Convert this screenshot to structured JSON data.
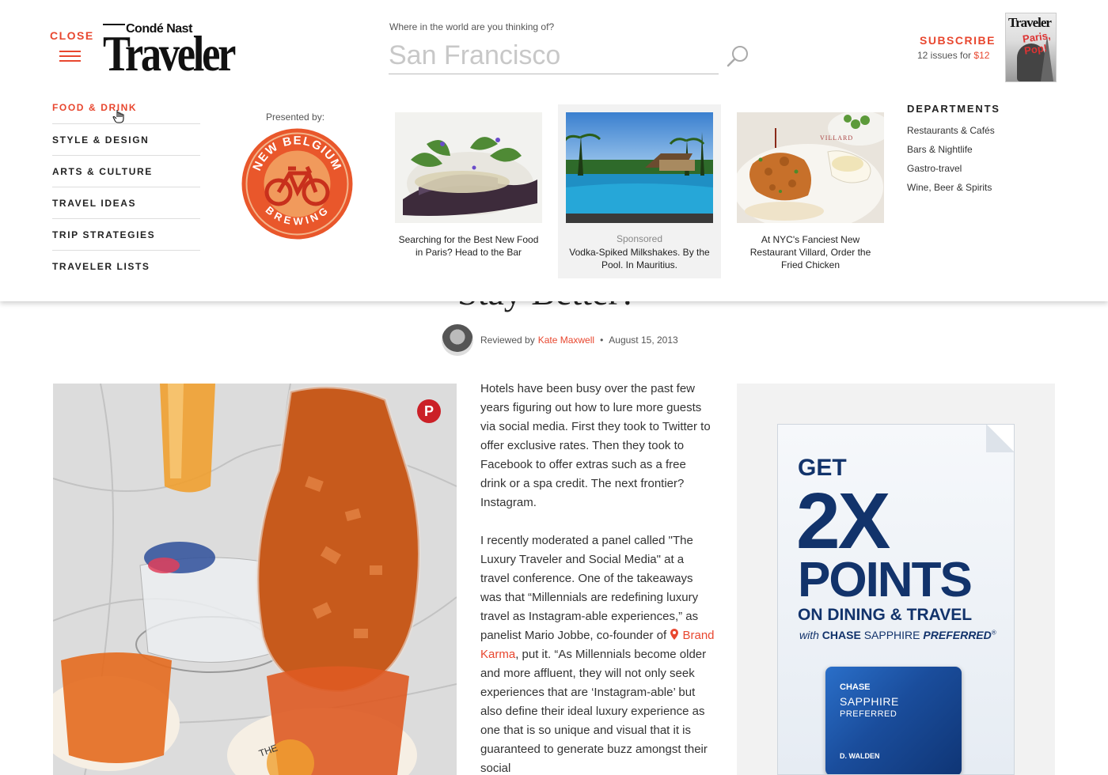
{
  "header": {
    "close_label": "CLOSE",
    "logo_small": "Condé Nast",
    "logo_big": "Traveler",
    "search_label": "Where in the world are you thinking of?",
    "search_placeholder": "San Francisco",
    "subscribe_label": "SUBSCRIBE",
    "subscribe_offer": "12 issues for",
    "subscribe_price": "$12",
    "magazine_cover_title": "Traveler",
    "magazine_cover_headline": "Paris, Pop!"
  },
  "nav": {
    "items": [
      {
        "label": "FOOD & DRINK",
        "active": true
      },
      {
        "label": "STYLE & DESIGN"
      },
      {
        "label": "ARTS & CULTURE"
      },
      {
        "label": "TRAVEL IDEAS"
      },
      {
        "label": "TRIP STRATEGIES"
      },
      {
        "label": "TRAVELER LISTS"
      }
    ]
  },
  "sponsor": {
    "presented_label": "Presented by:",
    "logo_top": "NEW BELGIUM",
    "logo_bottom": "BREWING"
  },
  "cards": [
    {
      "caption": "Searching for the Best New Food in Paris? Head to the Bar"
    },
    {
      "sponsored_label": "Sponsored",
      "caption": "Vodka-Spiked Milkshakes. By the Pool. In Mauritius."
    },
    {
      "caption": "At NYC's Fanciest New Restaurant Villard, Order the Fried Chicken",
      "plate_text": "VILLARD"
    }
  ],
  "departments": {
    "title": "DEPARTMENTS",
    "items": [
      "Restaurants & Cafés",
      "Bars & Nightlife",
      "Gastro-travel",
      "Wine, Beer & Spirits"
    ]
  },
  "article": {
    "title_peek": "Stay Better?",
    "reviewed_by": "Reviewed by",
    "author": "Kate Maxwell",
    "date": "August 15, 2013",
    "pin_label": "P",
    "p1": "Hotels have been busy over the past few years figuring out how to lure more guests via social media. First they took to Twitter to offer exclusive rates. Then they took to Facebook to offer extras such as a free drink or a spa credit. The next frontier? Instagram.",
    "p2_before": "I recently moderated a panel called \"The Luxury Traveler and Social Media\" at a travel conference. One of the takeaways was that “Millennials are redefining luxury travel as Instagram-able experiences,” as panelist Mario Jobbe, co-founder of",
    "p2_link": "Brand Karma",
    "p2_after": ", put it. “As Millennials become older and more affluent, they will not only seek experiences that are ‘Instagram-able’ but also define their ideal luxury experience as one that is so unique and visual that it is guaranteed to generate buzz amongst their social",
    "coaster_text": "THE"
  },
  "ad": {
    "get": "GET",
    "headline": "2X",
    "points": "POINTS",
    "sub": "ON DINING & TRAVEL",
    "with": "with",
    "brand": "CHASE",
    "product": "SAPPHIRE",
    "preferred": "PREFERRED",
    "reg": "®",
    "card_bank": "CHASE",
    "card_name": "SAPPHIRE",
    "card_tier": "PREFERRED",
    "card_holder": "D. WALDEN"
  },
  "colors": {
    "accent": "#e8472f",
    "chase_blue": "#12336b",
    "pinterest": "#cb2027"
  }
}
